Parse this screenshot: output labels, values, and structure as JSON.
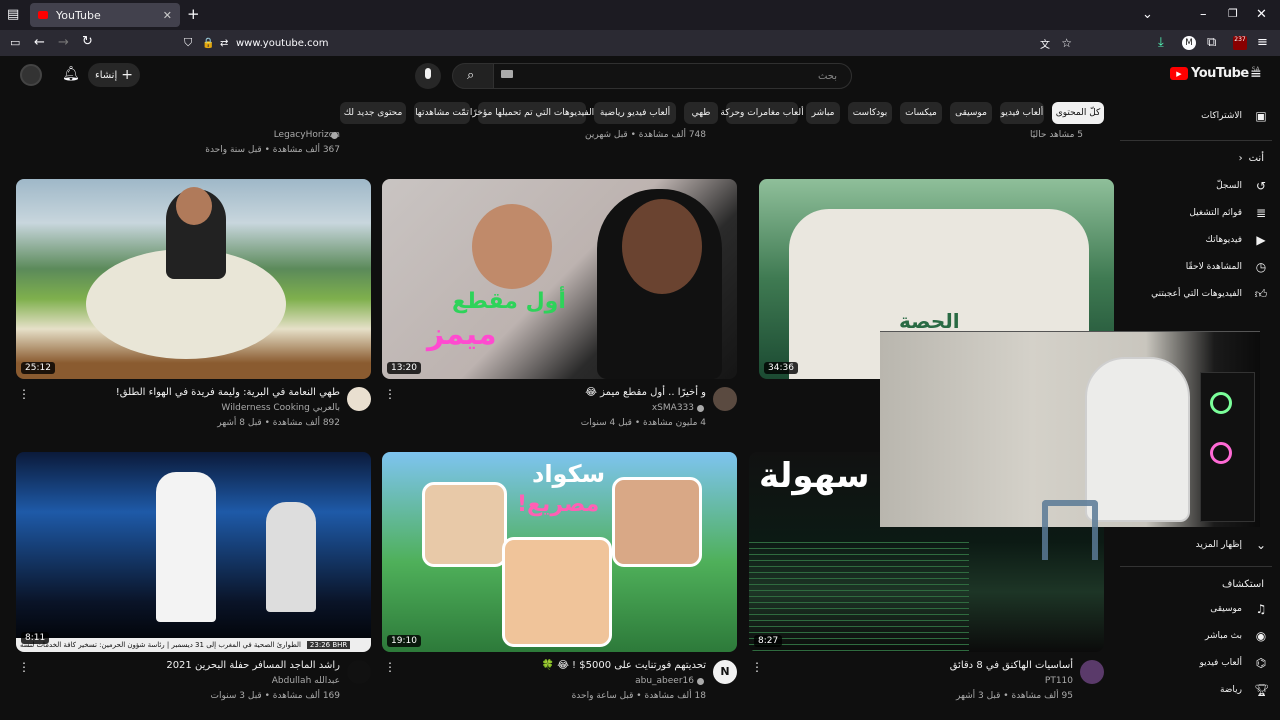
{
  "browser": {
    "tab_title": "YouTube",
    "url": "www.youtube.com",
    "ext_badge": "237"
  },
  "header": {
    "search_placeholder": "بحث",
    "create_label": "إنشاء",
    "logo_text": "YouTube",
    "logo_region": "SA"
  },
  "chips": [
    "كلّ المحتوى",
    "ألعاب فيديو",
    "موسيقى",
    "ميكسات",
    "بودكاست",
    "مباشر",
    "ألعاب مغامرات وحركة",
    "طهي",
    "ألعاب فيديو رياضية",
    "الفيديوهات التي تم تحميلها مؤخرًا",
    "تمّت مشاهدتها",
    "محتوى جديد لك"
  ],
  "prev_row": [
    {
      "channel": "LegacyHorizon",
      "meta": "367 ألف مشاهدة • قبل سنة واحدة"
    },
    {
      "channel": "",
      "meta": "748 ألف مشاهدة • قبل شهرين"
    },
    {
      "channel": "",
      "meta": "5 مشاهد حاليًا"
    }
  ],
  "videos": [
    {
      "title": "طهي النعامة في البرية: وليمة فريدة في الهواء الطلق!",
      "channel": "Wilderness Cooking بالعربي",
      "meta": "892 ألف مشاهدة • قبل 8 أشهر",
      "duration": "25:12"
    },
    {
      "title": "و أخيرًا .. أول مقطع ميمز 😂",
      "channel": "xSMA333",
      "meta": "4 مليون مشاهدة • قبل 4 سنوات",
      "duration": "13:20",
      "overlay1": "أول مقطع",
      "overlay2": "ميمز"
    },
    {
      "title": "",
      "channel": "",
      "meta": "",
      "duration": "34:36",
      "overlay1": "الحصة"
    },
    {
      "title": "راشد الماجد المسافر حفلة البحرين 2021",
      "channel": "Abdullah عبدالله",
      "meta": "169 ألف مشاهدة • قبل 3 سنوات",
      "duration": "8:11",
      "ticker": "الطوارئ الصحية في المغرب إلى 31 ديسمبر | رئاسة شؤون الحرمين: تسخير كافة الخدمات لتسه",
      "ticker_time": "23:26 BHR"
    },
    {
      "title": "تحديتهم فورتنايت على 5000$ ! 😂 🍀",
      "channel": "abu_abeer16",
      "meta": "18 ألف مشاهدة • قبل ساعة واحدة",
      "duration": "19:10",
      "overlay1": "سكواد",
      "overlay2": "مصريع!"
    },
    {
      "title": "أساسيات الهاكنق في 8 دقائق",
      "channel": "PT110",
      "meta": "95 ألف مشاهدة • قبل 3 أشهر",
      "duration": "8:27",
      "overlay1": "سهولة"
    }
  ],
  "sidebar": {
    "subscriptions": "الاشتراكات",
    "you": "أنت",
    "items": [
      {
        "label": "السجلّ",
        "icon": "history-icon"
      },
      {
        "label": "قوائم التشغيل",
        "icon": "playlist-icon"
      },
      {
        "label": "فيديوهاتك",
        "icon": "your-videos-icon"
      },
      {
        "label": "المشاهدة لاحقًا",
        "icon": "watch-later-icon"
      },
      {
        "label": "الفيديوهات التي أعجبتني",
        "icon": "like-icon"
      }
    ],
    "show_more": "إظهار المزيد",
    "explore": "استكشاف",
    "explore_items": [
      {
        "label": "موسيقى",
        "icon": "music-icon"
      },
      {
        "label": "بث مباشر",
        "icon": "live-icon"
      },
      {
        "label": "ألعاب فيديو",
        "icon": "gaming-icon"
      },
      {
        "label": "رياضة",
        "icon": "trophy-icon"
      }
    ]
  },
  "colors": {
    "bg": "#0f0f0f",
    "accent": "#ff0000",
    "chip": "#272727"
  }
}
